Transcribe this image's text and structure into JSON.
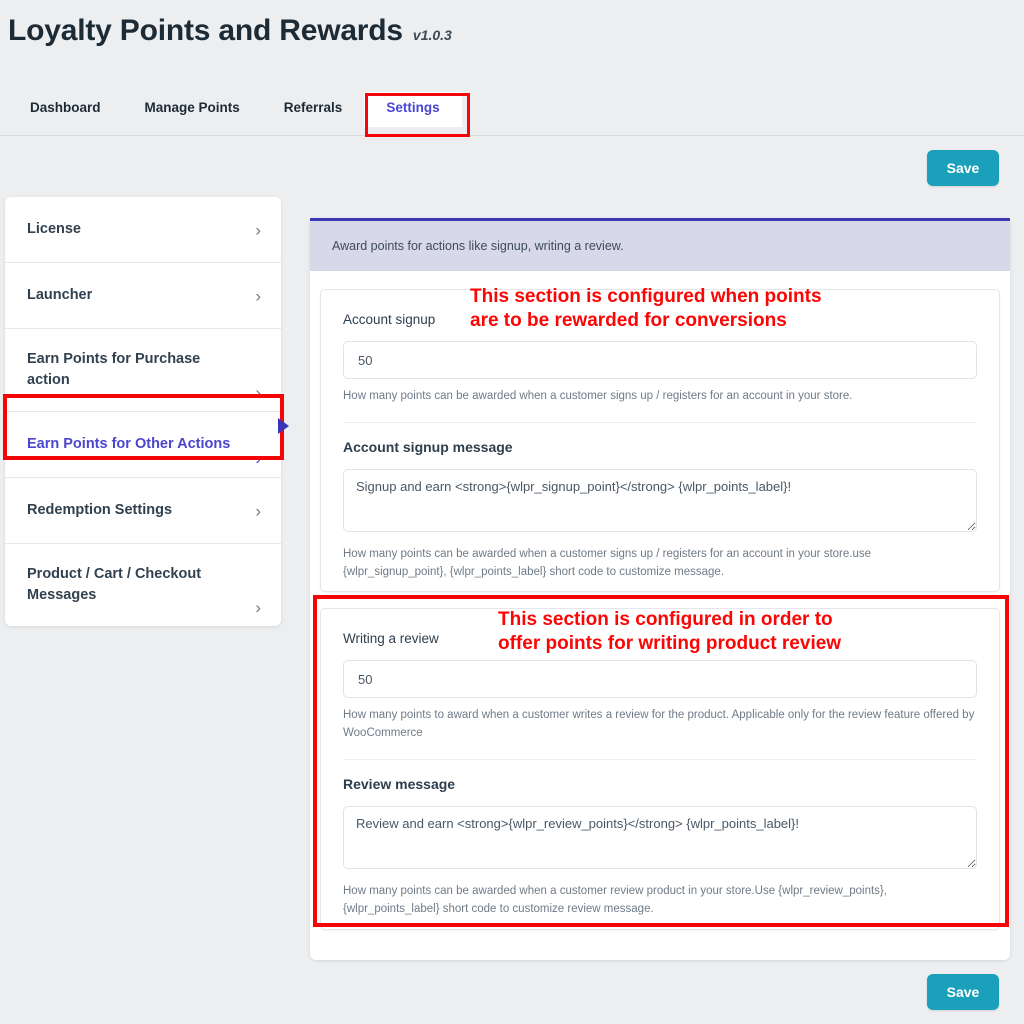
{
  "header": {
    "title": "Loyalty Points and Rewards",
    "version": "v1.0.3"
  },
  "tabs": [
    {
      "label": "Dashboard",
      "active": false
    },
    {
      "label": "Manage Points",
      "active": false
    },
    {
      "label": "Referrals",
      "active": false
    },
    {
      "label": "Settings",
      "active": true
    }
  ],
  "toolbar": {
    "save_label": "Save",
    "save_label_bottom": "Save"
  },
  "sidebar": {
    "items": [
      {
        "label": "License",
        "chevron": "›",
        "active": false
      },
      {
        "label": "Launcher",
        "chevron": "›",
        "active": false
      },
      {
        "label": "Earn Points for Purchase action",
        "chevron": "›",
        "active": false
      },
      {
        "label": "Earn Points for Other Actions",
        "chevron": "›",
        "active": true
      },
      {
        "label": "Redemption Settings",
        "chevron": "›",
        "active": false
      },
      {
        "label": "Product / Cart / Checkout Messages",
        "chevron": "›",
        "active": false
      }
    ]
  },
  "main": {
    "banner": "Award points for actions like signup, writing a review.",
    "signup_section": {
      "points_label": "Account signup",
      "points_value": "50",
      "points_help": "How many points can be awarded when a customer signs up / registers for an account in your store.",
      "message_label": "Account signup message",
      "message_value": "Signup and earn <strong>{wlpr_signup_point}</strong> {wlpr_points_label}!",
      "message_help": "How many points can be awarded when a customer signs up / registers for an account in your store.use {wlpr_signup_point}, {wlpr_points_label} short code to customize message."
    },
    "review_section": {
      "points_label": "Writing a review",
      "points_value": "50",
      "points_help": "How many points to award when a customer writes a review for the product. Applicable only for the review feature offered by WooCommerce",
      "message_label": "Review message",
      "message_value": "Review and earn <strong>{wlpr_review_points}</strong> {wlpr_points_label}!",
      "message_help": "How many points can be awarded when a customer review product in your store.Use {wlpr_review_points},{wlpr_points_label} short code to customize review message."
    }
  },
  "annotations": {
    "signup": "This section is configured when points\nare to be rewarded for conversions",
    "review": "This section is configured in order to\noffer points for writing product review",
    "color": "#fb0505"
  },
  "colors": {
    "accent_save": "#1aa0bb",
    "active_link": "#4a46cf",
    "banner_border": "#3d39b5",
    "banner_bg": "#d7d9e8",
    "page_bg": "#eceef0"
  }
}
